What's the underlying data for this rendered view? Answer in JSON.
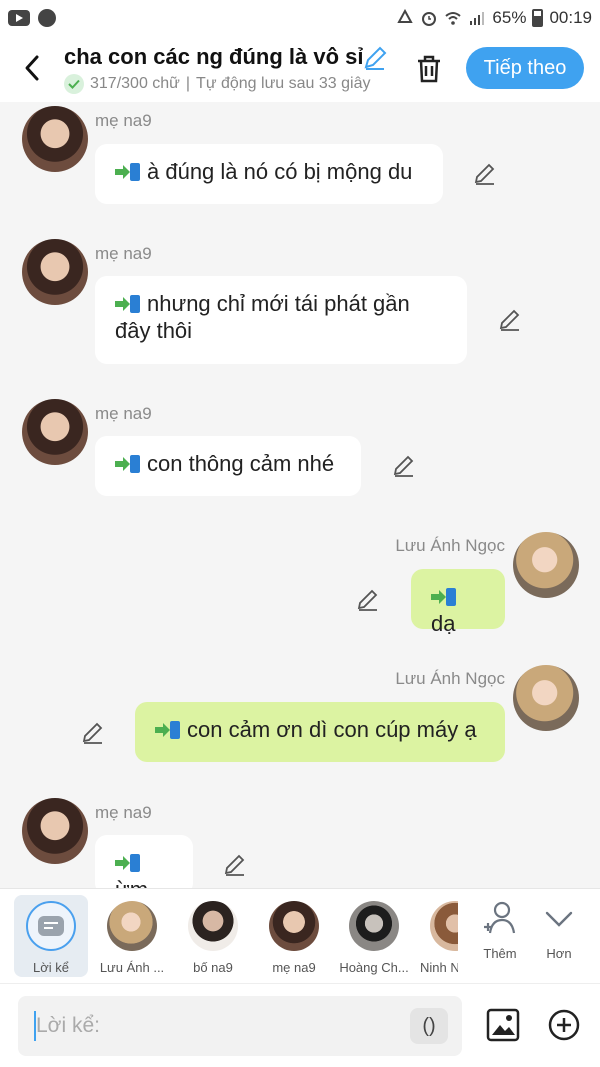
{
  "status_bar": {
    "battery": "65%",
    "time": "00:19"
  },
  "header": {
    "title": "cha con các ng đúng là vô sỉ",
    "word_count": "317/300 chữ",
    "autosave": "Tự động lưu sau 33 giây",
    "next_label": "Tiếp theo"
  },
  "messages": [
    {
      "side": "left",
      "sender": "mẹ na9",
      "text": "à đúng là nó có bị mộng du"
    },
    {
      "side": "left",
      "sender": "mẹ na9",
      "text": "nhưng chỉ mới tái phát gần đây thôi"
    },
    {
      "side": "left",
      "sender": "mẹ na9",
      "text": "con thông cảm nhé"
    },
    {
      "side": "right",
      "sender": "Lưu Ánh Ngọc",
      "text": "dạ"
    },
    {
      "side": "right",
      "sender": "Lưu Ánh Ngọc",
      "text": "con cảm ơn dì con cúp máy ạ"
    },
    {
      "side": "left",
      "sender": "mẹ na9",
      "text": "ừm"
    }
  ],
  "characters": [
    {
      "label": "Lời kể"
    },
    {
      "label": "Lưu Ánh ..."
    },
    {
      "label": "bố na9"
    },
    {
      "label": "mẹ na9"
    },
    {
      "label": "Hoàng Ch..."
    },
    {
      "label": "Ninh N"
    }
  ],
  "actions": {
    "add_label": "Thêm",
    "more_label": "Hơn"
  },
  "input": {
    "placeholder": "Lời kể:",
    "paren_label": "()"
  },
  "colors": {
    "accent": "#3fa2f0",
    "right_bubble": "#dcf3a2",
    "left_bubble": "#ffffff",
    "check": "#4caf50"
  }
}
